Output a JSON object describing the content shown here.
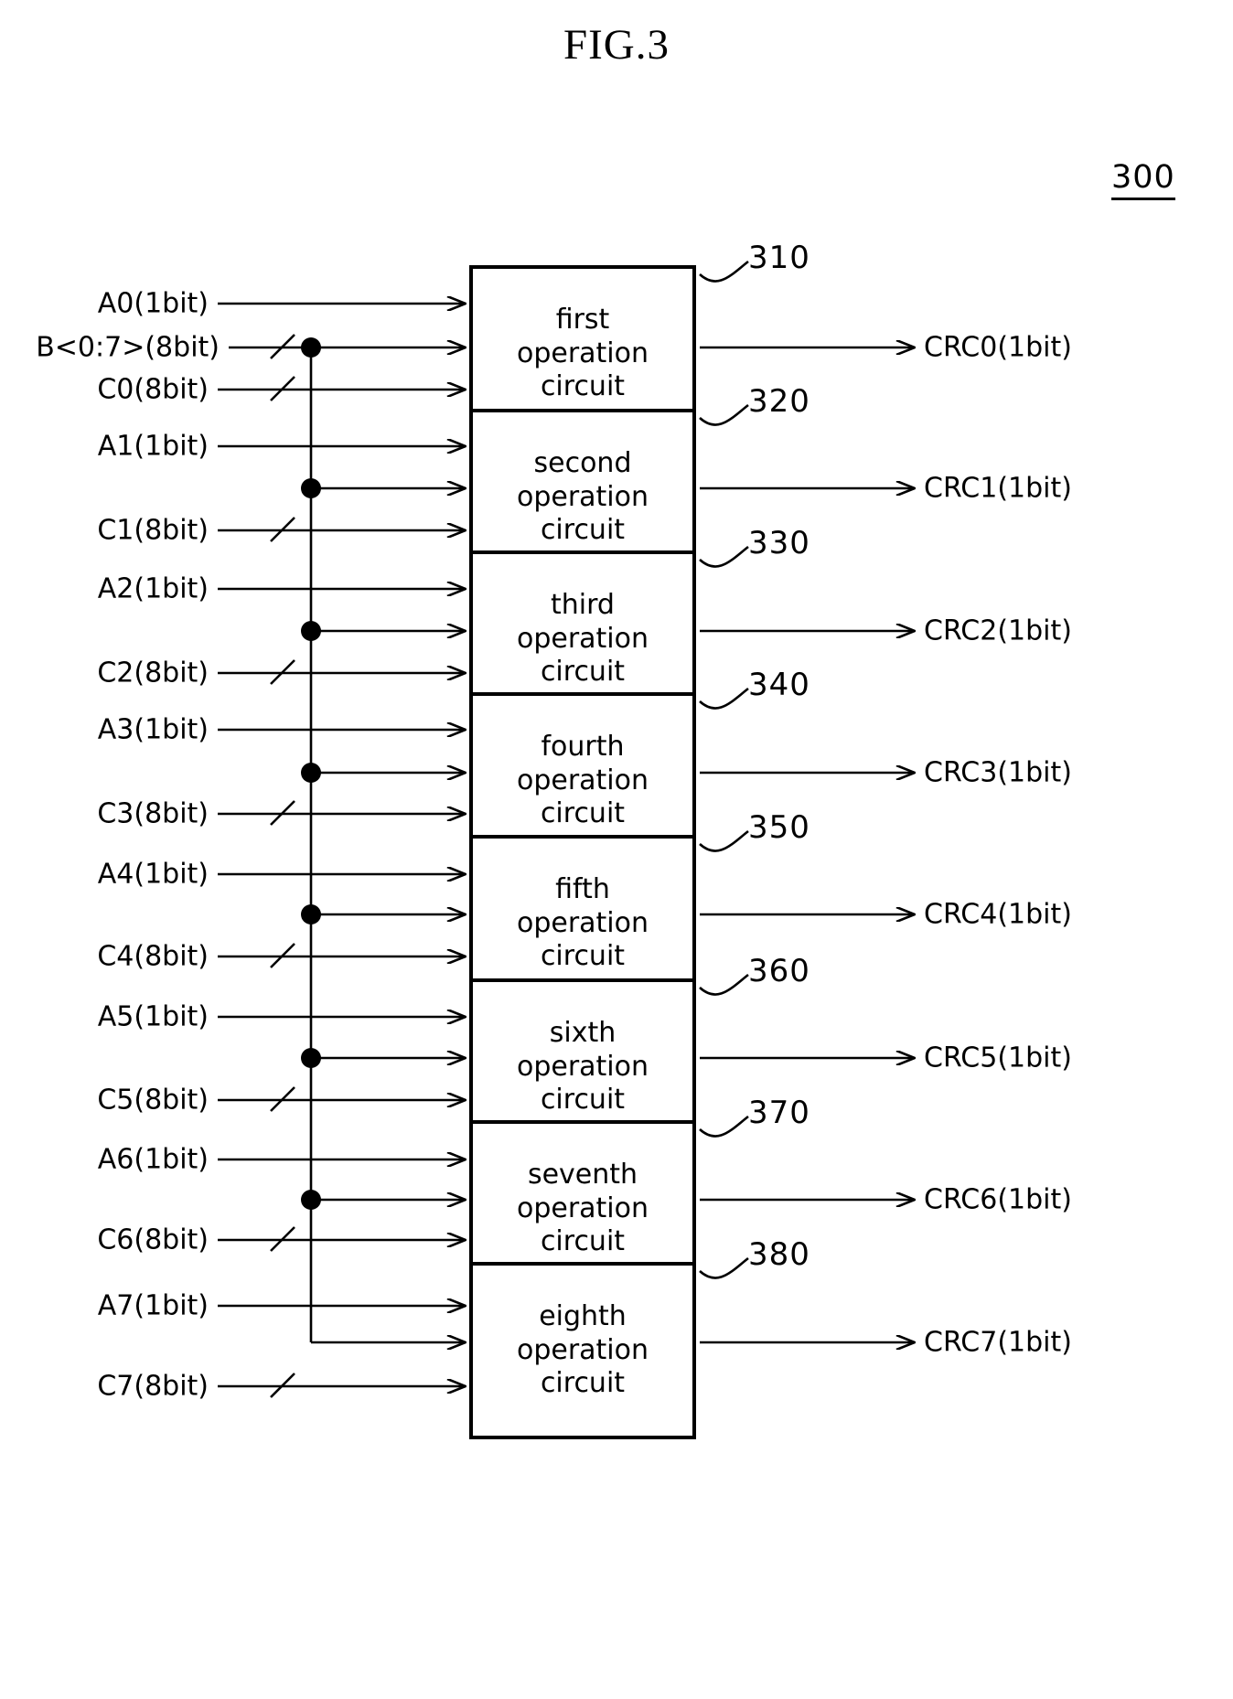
{
  "figure": {
    "title": "FIG.3",
    "reference_numeral": "300"
  },
  "blocks": [
    {
      "id": "310",
      "line1": "first",
      "line2": "operation",
      "line3": "circuit",
      "inputs": [
        "A0(1bit)",
        "B<0:7>(8bit)",
        "C0(8bit)"
      ],
      "output": "CRC0(1bit)"
    },
    {
      "id": "320",
      "line1": "second",
      "line2": "operation",
      "line3": "circuit",
      "inputs": [
        "A1(1bit)",
        "",
        "C1(8bit)"
      ],
      "output": "CRC1(1bit)"
    },
    {
      "id": "330",
      "line1": "third",
      "line2": "operation",
      "line3": "circuit",
      "inputs": [
        "A2(1bit)",
        "",
        "C2(8bit)"
      ],
      "output": "CRC2(1bit)"
    },
    {
      "id": "340",
      "line1": "fourth",
      "line2": "operation",
      "line3": "circuit",
      "inputs": [
        "A3(1bit)",
        "",
        "C3(8bit)"
      ],
      "output": "CRC3(1bit)"
    },
    {
      "id": "350",
      "line1": "fifth",
      "line2": "operation",
      "line3": "circuit",
      "inputs": [
        "A4(1bit)",
        "",
        "C4(8bit)"
      ],
      "output": "CRC4(1bit)"
    },
    {
      "id": "360",
      "line1": "sixth",
      "line2": "operation",
      "line3": "circuit",
      "inputs": [
        "A5(1bit)",
        "",
        "C5(8bit)"
      ],
      "output": "CRC5(1bit)"
    },
    {
      "id": "370",
      "line1": "seventh",
      "line2": "operation",
      "line3": "circuit",
      "inputs": [
        "A6(1bit)",
        "",
        "C6(8bit)"
      ],
      "output": "CRC6(1bit)"
    },
    {
      "id": "380",
      "line1": "eighth",
      "line2": "operation",
      "line3": "circuit",
      "inputs": [
        "A7(1bit)",
        "",
        "C7(8bit)"
      ],
      "output": "CRC7(1bit)"
    }
  ],
  "input_labels": {
    "a0": "A0(1bit)",
    "b": "B<0:7>(8bit)",
    "c0": "C0(8bit)",
    "a1": "A1(1bit)",
    "c1": "C1(8bit)",
    "a2": "A2(1bit)",
    "c2": "C2(8bit)",
    "a3": "A3(1bit)",
    "c3": "C3(8bit)",
    "a4": "A4(1bit)",
    "c4": "C4(8bit)",
    "a5": "A5(1bit)",
    "c5": "C5(8bit)",
    "a6": "A6(1bit)",
    "c6": "C6(8bit)",
    "a7": "A7(1bit)",
    "c7": "C7(8bit)"
  },
  "output_labels": {
    "crc0": "CRC0(1bit)",
    "crc1": "CRC1(1bit)",
    "crc2": "CRC2(1bit)",
    "crc3": "CRC3(1bit)",
    "crc4": "CRC4(1bit)",
    "crc5": "CRC5(1bit)",
    "crc6": "CRC6(1bit)",
    "crc7": "CRC7(1bit)"
  },
  "callouts": {
    "c310": "310",
    "c320": "320",
    "c330": "330",
    "c340": "340",
    "c350": "350",
    "c360": "360",
    "c370": "370",
    "c380": "380"
  },
  "style": {
    "line_color": "#000000",
    "background": "#ffffff"
  }
}
